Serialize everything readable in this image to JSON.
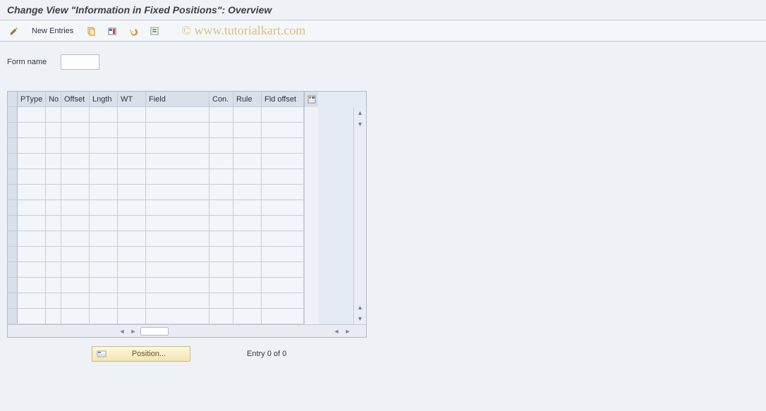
{
  "title": "Change View \"Information in Fixed Positions\": Overview",
  "toolbar": {
    "new_entries_label": "New Entries"
  },
  "watermark": "©  www.tutorialkart.com",
  "form": {
    "name_label": "Form name",
    "name_value": ""
  },
  "grid": {
    "columns": [
      "PType",
      "No",
      "Offset",
      "Lngth",
      "WT",
      "Field",
      "Con.",
      "Rule",
      "Fld offset"
    ],
    "visible_row_count": 14
  },
  "footer": {
    "position_label": "Position...",
    "entry_text": "Entry 0 of 0"
  }
}
